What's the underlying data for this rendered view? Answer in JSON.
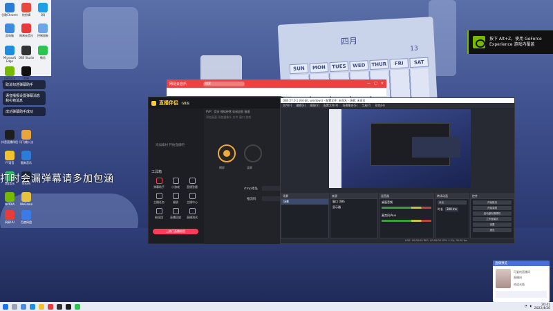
{
  "desktop": {
    "subtitle": "打时会漏弹幕请多加包涵",
    "notifications": [
      "取消勾选弹幕助手",
      "语音播报设置弹幕消息和礼物消息",
      "成功弹幕助手成功"
    ],
    "icons": [
      {
        "label": "谷歌Chrome",
        "color": "#2b7bd8"
      },
      {
        "label": "快剪辑",
        "color": "#e8493c"
      },
      {
        "label": "QQ",
        "color": "#1ea0e8"
      },
      {
        "label": "此电脑",
        "color": "#3d8be0"
      },
      {
        "label": "网易云音乐",
        "color": "#e53b3b"
      },
      {
        "label": "控制面板",
        "color": "#6aa6e8"
      },
      {
        "label": "Microsoft Edge",
        "color": "#1c8ee0"
      },
      {
        "label": "OBS Studio",
        "color": "#333"
      },
      {
        "label": "微信",
        "color": "#2ac44e"
      },
      {
        "label": "GeForce Experience",
        "color": "#76b900"
      },
      {
        "label": "剪映",
        "color": "#111"
      },
      {
        "label": "抖音直播伴侣",
        "color": "#1e1e1e"
      },
      {
        "label": "讯飞输入法",
        "color": "#e8a53b"
      },
      {
        "label": "YY语音",
        "color": "#f2c12e"
      },
      {
        "label": "酷狗音乐",
        "color": "#2b7bd8"
      },
      {
        "label": "QQ音乐",
        "color": "#2fc46a"
      },
      {
        "label": "Steam",
        "color": "#1b2838"
      },
      {
        "label": "NVIDIA",
        "color": "#76b900"
      },
      {
        "label": "WeGame",
        "color": "#e8c23e"
      },
      {
        "label": "网易UU",
        "color": "#e83b3b"
      },
      {
        "label": "百度网盘",
        "color": "#3b7be8"
      }
    ]
  },
  "geforce": {
    "line1": "按下 Alt+Z，使用 GeForce",
    "line2": "Experience 游戏内覆盖"
  },
  "music": {
    "title": "网易云音乐",
    "search_placeholder": "搜索"
  },
  "zhibo": {
    "brand": "直播伴侣",
    "version": "V4.6",
    "sidebar_hint": "添加素材 开始直播吧",
    "tools_title": "工具箱",
    "tools": [
      "弹幕助手",
      "小游戏",
      "直播答题",
      "主播任务",
      "福袋",
      "主播中心",
      "粉丝团",
      "直播回放",
      "直播测试"
    ],
    "tabs": "PVP：竞技 模拟经营 休闲益智 推理",
    "options": "添加画面  添加摄像头  文件  窗口  游戏",
    "rtmp_label": "rtmp地址",
    "key_label": "推流码",
    "bottom_pill": "上热门直播带货",
    "circle_labels": [
      "横屏",
      "竖屏"
    ]
  },
  "obs": {
    "title": "OBS 27.0.1 (64-bit, windows) - 配置文件: 未命名 - 场景: 未命名",
    "menu": [
      "文件(F)",
      "编辑(E)",
      "视图(V)",
      "配置文件(P)",
      "场景集合(S)",
      "工具(T)",
      "帮助(H)"
    ],
    "docks": {
      "scenes": "场景",
      "sources": "来源",
      "mixer": "混音器",
      "transitions": "转场动画",
      "controls": "控件"
    },
    "scene_item": "场景",
    "source_items": [
      "窗口 OBS",
      "显示器"
    ],
    "mixer_tracks": [
      "桌面音频",
      "麦克风/Aux"
    ],
    "transition_value": "淡出",
    "duration_label": "时长",
    "duration_value": "300 ms",
    "controls": [
      "开始推流",
      "开始录制",
      "启动虚拟摄像机",
      "工作室模式",
      "设置",
      "退出"
    ],
    "status": "LIVE: 00:00:00  REC: 00:00:00  CPU: 1.2%, 30.00 fps"
  },
  "chat": {
    "header": "直播预览",
    "line1": "可爱的直播间",
    "line2": "直播间",
    "line3": "欢迎光临"
  },
  "taskbar": {
    "time": "20:41",
    "date": "2022/4/26"
  },
  "calendar": {
    "month": "四月",
    "number": "13",
    "days": [
      "SUN",
      "MON",
      "TUES",
      "WED",
      "THUR",
      "FRI",
      "SAT"
    ]
  }
}
